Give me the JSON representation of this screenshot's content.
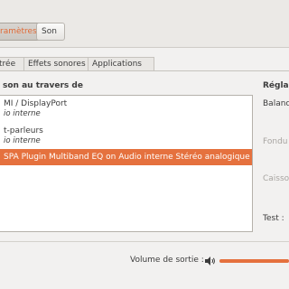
{
  "crumbs": [
    {
      "label": "ramètres",
      "active": true
    },
    {
      "label": "Son",
      "active": false
    }
  ],
  "tabs": [
    {
      "label": "trée",
      "selected": false
    },
    {
      "label": "Effets sonores",
      "selected": false
    },
    {
      "label": "Applications",
      "selected": false
    }
  ],
  "output": {
    "heading": "son au travers de",
    "devices": [
      {
        "name": "MI / DisplayPort",
        "sub": "io interne",
        "selected": false
      },
      {
        "name": "t-parleurs",
        "sub": "io interne",
        "selected": false
      },
      {
        "name": "SPA Plugin Multiband EQ on Audio interne Stéréo analogique",
        "sub": "",
        "selected": true
      }
    ]
  },
  "side": {
    "heading": "Régla",
    "balance": "Balanc",
    "fondu": "Fondu",
    "caisson": "Caisso",
    "test": "Test :"
  },
  "volume": {
    "label": "Volume de sortie :",
    "icon": "speaker-volume-icon",
    "level": 1.0
  },
  "colors": {
    "accent": "#e5713e",
    "disabled_text": "#a8a5a1"
  }
}
